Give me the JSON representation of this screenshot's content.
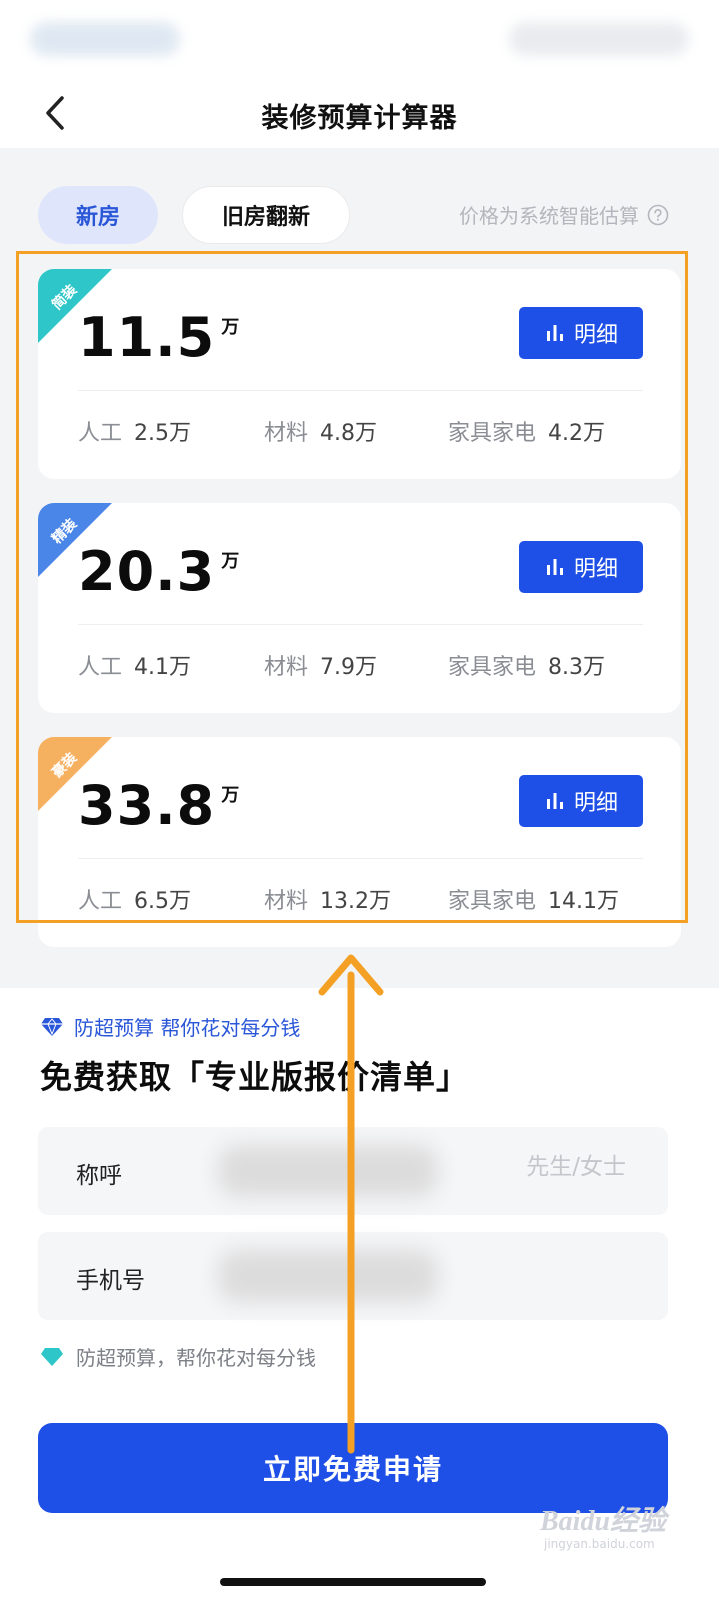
{
  "header": {
    "title": "装修预算计算器"
  },
  "tabs": [
    {
      "label": "新房",
      "active": true
    },
    {
      "label": "旧房翻新",
      "active": false
    }
  ],
  "price_note": "价格为系统智能估算",
  "detail_label": "明细",
  "plans": [
    {
      "tier": "简装",
      "tier_color": "#2ec6c8",
      "total": "11.5",
      "unit": "万",
      "labor_label": "人工",
      "labor": "2.5万",
      "material_label": "材料",
      "material": "4.8万",
      "furniture_label": "家具家电",
      "furniture": "4.2万"
    },
    {
      "tier": "精装",
      "tier_color": "#4a86e8",
      "total": "20.3",
      "unit": "万",
      "labor_label": "人工",
      "labor": "4.1万",
      "material_label": "材料",
      "material": "7.9万",
      "furniture_label": "家具家电",
      "furniture": "8.3万"
    },
    {
      "tier": "豪装",
      "tier_color": "#f5b060",
      "total": "33.8",
      "unit": "万",
      "labor_label": "人工",
      "labor": "6.5万",
      "material_label": "材料",
      "material": "13.2万",
      "furniture_label": "家具家电",
      "furniture": "14.1万"
    }
  ],
  "form": {
    "slogan": "防超预算 帮你花对每分钱",
    "headline": "免费获取「专业版报价清单」",
    "name_label": "称呼",
    "name_placeholder": "先生/女士",
    "phone_label": "手机号",
    "phone_placeholder": "",
    "tip": "防超预算，帮你花对每分钱",
    "submit_label": "立即免费申请"
  },
  "watermark": {
    "text": "Baidu经验",
    "sub": "jingyan.baidu.com"
  },
  "colors": {
    "primary": "#1e4fe6",
    "annotation": "#f3a024"
  }
}
